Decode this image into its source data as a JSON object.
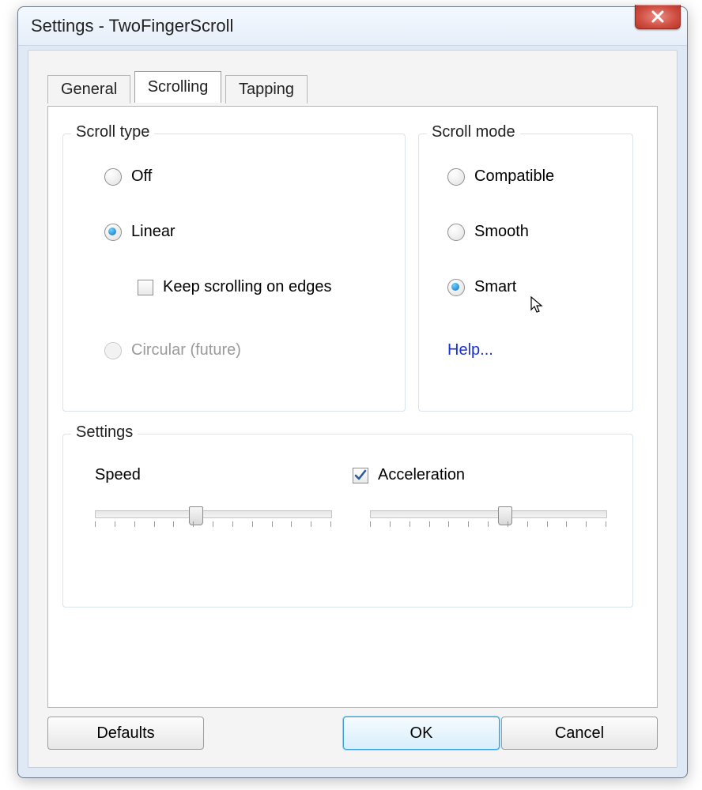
{
  "window": {
    "title": "Settings - TwoFingerScroll"
  },
  "tabs": {
    "general": "General",
    "scrolling": "Scrolling",
    "tapping": "Tapping",
    "active": "scrolling"
  },
  "scroll_type": {
    "legend": "Scroll type",
    "off": "Off",
    "linear": "Linear",
    "keep_edges": "Keep scrolling on edges",
    "circular": "Circular (future)",
    "selected": "linear",
    "keep_edges_checked": false
  },
  "scroll_mode": {
    "legend": "Scroll mode",
    "compatible": "Compatible",
    "smooth": "Smooth",
    "smart": "Smart",
    "help": "Help...",
    "selected": "smart"
  },
  "settings": {
    "legend": "Settings",
    "speed_label": "Speed",
    "accel_label": "Acceleration",
    "accel_checked": true,
    "speed_value": 0.42,
    "accel_value": 0.57
  },
  "buttons": {
    "defaults": "Defaults",
    "ok": "OK",
    "cancel": "Cancel"
  }
}
